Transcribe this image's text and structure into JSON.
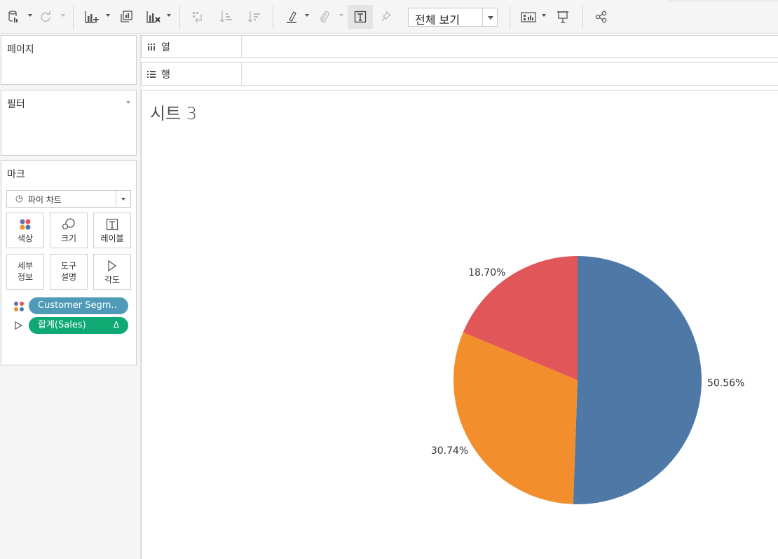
{
  "toolbar": {
    "view_select": "전체 보기"
  },
  "panels": {
    "pages_title": "페이지",
    "filters_title": "필터",
    "marks_title": "마크"
  },
  "marks": {
    "type": "파이 차트",
    "buttons": {
      "color": "색상",
      "size": "크기",
      "label": "레이블",
      "detail_line1": "세부",
      "detail_line2": "정보",
      "tooltip_line1": "도구",
      "tooltip_line2": "설명",
      "angle": "각도"
    },
    "pills": {
      "segment": "Customer Segm..",
      "sales": "합계(Sales)",
      "sales_delta": "Δ"
    }
  },
  "shelves": {
    "columns": "열",
    "rows": "행"
  },
  "sheet": {
    "title": "시트 3"
  },
  "chart_data": {
    "type": "pie",
    "categories": [
      "",
      "",
      ""
    ],
    "values": [
      50.56,
      30.74,
      18.7
    ],
    "labels": [
      "50.56%",
      "30.74%",
      "18.70%"
    ],
    "colors": [
      "#4e79a7",
      "#f28e2b",
      "#e15759"
    ],
    "title": "",
    "start_angle_deg": 0,
    "direction": "clockwise"
  },
  "colors": {
    "segment_pill": "#4f9bb7",
    "sales_pill": "#0fa974",
    "toolbar_bg": "#f5f5f5"
  }
}
